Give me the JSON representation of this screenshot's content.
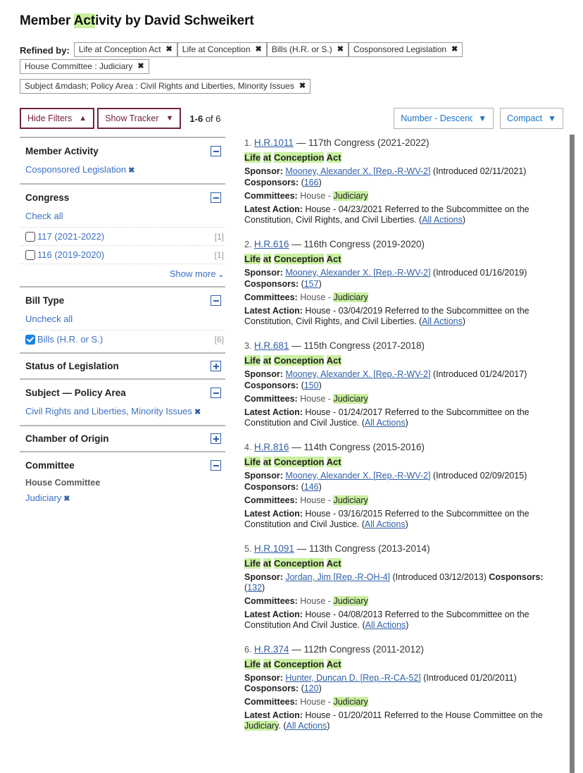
{
  "header": {
    "title_prefix": "Member ",
    "title_highlight": "Act",
    "title_suffix": "ivity by David Schweikert"
  },
  "refined_by": {
    "label": "Refined by:",
    "chips": [
      "Life at Conception Act",
      "Life at Conception",
      "Bills (H.R. or S.)",
      "Cosponsored Legislation",
      "House Committee : Judiciary",
      "Subject &mdash; Policy Area : Civil Rights and Liberties, Minority Issues"
    ],
    "remove_icon": "✖"
  },
  "controls": {
    "hide_filters_label": "Hide Filters",
    "hide_filters_caret": "▲",
    "show_tracker_label": "Show Tracker",
    "show_tracker_caret": "▼",
    "range_bold": "1-6",
    "range_rest": " of 6",
    "sort_value": "Number - Descending",
    "display_value": "Compact",
    "dropdown_caret": "▼"
  },
  "sidebar": {
    "facets": [
      {
        "title": "Member Activity",
        "toggle": "minus",
        "selected": "Cosponsored Legislation",
        "remove_icon": "✖"
      },
      {
        "title": "Congress",
        "toggle": "minus",
        "check_all": "Check all",
        "options": [
          {
            "label": "117 (2021-2022)",
            "count": "[1]",
            "checked": false
          },
          {
            "label": "116 (2019-2020)",
            "count": "[1]",
            "checked": false
          }
        ],
        "show_more": "Show more",
        "show_more_caret": "⌄"
      },
      {
        "title": "Bill Type",
        "toggle": "minus",
        "check_all": "Uncheck all",
        "options": [
          {
            "label": "Bills (H.R. or S.)",
            "count": "[6]",
            "checked": true
          }
        ]
      },
      {
        "title": "Status of Legislation",
        "toggle": "plus"
      },
      {
        "title": "Subject — Policy Area",
        "toggle": "minus",
        "selected": "Civil Rights and Liberties, Minority Issues",
        "remove_icon": "✖"
      },
      {
        "title": "Chamber of Origin",
        "toggle": "plus"
      },
      {
        "title": "Committee",
        "toggle": "minus",
        "sublabel": "House Committee",
        "selected": "Judiciary",
        "remove_icon": "✖"
      }
    ]
  },
  "results": {
    "labels": {
      "sponsor": "Sponsor:",
      "cosponsors": "Cosponsors:",
      "committees": "Committees:",
      "latest_action": "Latest Action:",
      "all_actions": "All Actions",
      "introduced_prefix": "(Introduced ",
      "introduced_suffix": ")",
      "house_dash": "House - ",
      "em_dash": "—"
    },
    "items": [
      {
        "num": "1.",
        "bill": "H.R.1011",
        "congress": "117th Congress (2021-2022)",
        "title_parts": [
          {
            "t": "Life",
            "h": true
          },
          {
            "t": " ",
            "h": false
          },
          {
            "t": "at",
            "h": true
          },
          {
            "t": " ",
            "h": false
          },
          {
            "t": "Conception",
            "h": true
          },
          {
            "t": " ",
            "h": false
          },
          {
            "t": "Act",
            "h": true
          }
        ],
        "sponsor": "Mooney, Alexander X. [Rep.-R-WV-2]",
        "introduced": "02/11/2021",
        "cosponsors": "166",
        "inline_cosponsors": false,
        "committee_chamber": "House - ",
        "committee": "Judiciary",
        "latest_action_text": "House - 04/23/2021 Referred to the Subcommittee on the Constitution, Civil Rights, and Civil Liberties. (",
        "latest_action_highlight": "",
        "latest_action_tail": ""
      },
      {
        "num": "2.",
        "bill": "H.R.616",
        "congress": "116th Congress (2019-2020)",
        "title_parts": [
          {
            "t": "Life",
            "h": true
          },
          {
            "t": " ",
            "h": false
          },
          {
            "t": "at",
            "h": true
          },
          {
            "t": " ",
            "h": false
          },
          {
            "t": "Conception",
            "h": true
          },
          {
            "t": " ",
            "h": false
          },
          {
            "t": "Act",
            "h": true
          }
        ],
        "sponsor": "Mooney, Alexander X. [Rep.-R-WV-2]",
        "introduced": "01/16/2019",
        "cosponsors": "157",
        "inline_cosponsors": false,
        "committee_chamber": "House - ",
        "committee": "Judiciary",
        "latest_action_text": "House - 03/04/2019 Referred to the Subcommittee on the Constitution, Civil Rights, and Civil Liberties. (",
        "latest_action_highlight": "",
        "latest_action_tail": ""
      },
      {
        "num": "3.",
        "bill": "H.R.681",
        "congress": "115th Congress (2017-2018)",
        "title_parts": [
          {
            "t": "Life",
            "h": true
          },
          {
            "t": " ",
            "h": false
          },
          {
            "t": "at",
            "h": true
          },
          {
            "t": " ",
            "h": false
          },
          {
            "t": "Conception",
            "h": true
          },
          {
            "t": " ",
            "h": false
          },
          {
            "t": "Act",
            "h": true
          }
        ],
        "sponsor": "Mooney, Alexander X. [Rep.-R-WV-2]",
        "introduced": "01/24/2017",
        "cosponsors": "150",
        "inline_cosponsors": false,
        "committee_chamber": "House - ",
        "committee": "Judiciary",
        "latest_action_text": "House - 01/24/2017 Referred to the Subcommittee on the Constitution and Civil Justice. (",
        "latest_action_highlight": "",
        "latest_action_tail": ""
      },
      {
        "num": "4.",
        "bill": "H.R.816",
        "congress": "114th Congress (2015-2016)",
        "title_parts": [
          {
            "t": "Life",
            "h": true
          },
          {
            "t": " ",
            "h": false
          },
          {
            "t": "at",
            "h": true
          },
          {
            "t": " ",
            "h": false
          },
          {
            "t": "Conception",
            "h": true
          },
          {
            "t": " ",
            "h": false
          },
          {
            "t": "Act",
            "h": true
          }
        ],
        "sponsor": "Mooney, Alexander X. [Rep.-R-WV-2]",
        "introduced": "02/09/2015",
        "cosponsors": "146",
        "inline_cosponsors": false,
        "committee_chamber": "House - ",
        "committee": "Judiciary",
        "latest_action_text": "House - 03/16/2015 Referred to the Subcommittee on the Constitution and Civil Justice. (",
        "latest_action_highlight": "",
        "latest_action_tail": ""
      },
      {
        "num": "5.",
        "bill": "H.R.1091",
        "congress": "113th Congress (2013-2014)",
        "title_parts": [
          {
            "t": "Life",
            "h": true
          },
          {
            "t": " ",
            "h": false
          },
          {
            "t": "at",
            "h": true
          },
          {
            "t": " ",
            "h": false
          },
          {
            "t": "Conception",
            "h": true
          },
          {
            "t": " ",
            "h": false
          },
          {
            "t": "Act",
            "h": true
          }
        ],
        "sponsor": "Jordan, Jim [Rep.-R-OH-4]",
        "introduced": "03/12/2013",
        "cosponsors": "132",
        "inline_cosponsors": true,
        "committee_chamber": "House - ",
        "committee": "Judiciary",
        "latest_action_text": "House - 04/08/2013 Referred to the Subcommittee on the Constitution And Civil Justice. (",
        "latest_action_highlight": "",
        "latest_action_tail": ""
      },
      {
        "num": "6.",
        "bill": "H.R.374",
        "congress": "112th Congress (2011-2012)",
        "title_parts": [
          {
            "t": "Life",
            "h": true
          },
          {
            "t": " ",
            "h": false
          },
          {
            "t": "at",
            "h": true
          },
          {
            "t": " ",
            "h": false
          },
          {
            "t": "Conception",
            "h": true
          },
          {
            "t": " ",
            "h": false
          },
          {
            "t": "Act",
            "h": true
          }
        ],
        "sponsor": "Hunter, Duncan D. [Rep.-R-CA-52]",
        "introduced": "01/20/2011",
        "cosponsors": "120",
        "inline_cosponsors": true,
        "committee_chamber": "House - ",
        "committee": "Judiciary",
        "latest_action_text": "House - 01/20/2011 Referred to the House Committee on the ",
        "latest_action_highlight": "Judiciary",
        "latest_action_tail": ". ("
      }
    ]
  }
}
